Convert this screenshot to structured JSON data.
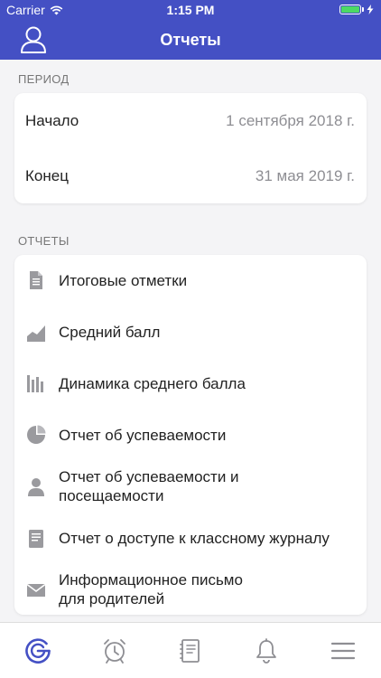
{
  "status_bar": {
    "carrier": "Carrier",
    "time": "1:15 PM"
  },
  "header": {
    "title": "Отчеты"
  },
  "period": {
    "section_label": "ПЕРИОД",
    "start": {
      "label": "Начало",
      "value": "1 сентября 2018 г."
    },
    "end": {
      "label": "Конец",
      "value": "31 мая 2019 г."
    }
  },
  "reports": {
    "section_label": "ОТЧЕТЫ",
    "items": [
      {
        "label": "Итоговые отметки",
        "icon": "document-icon"
      },
      {
        "label": "Средний балл",
        "icon": "area-chart-icon"
      },
      {
        "label": "Динамика среднего балла",
        "icon": "bar-chart-icon"
      },
      {
        "label": "Отчет об успеваемости",
        "icon": "pie-chart-icon"
      },
      {
        "label_line1": "Отчет об успеваемости и",
        "label_line2": "посещаемости",
        "icon": "person-icon"
      },
      {
        "label": "Отчет о доступе к классному журналу",
        "icon": "journal-icon"
      },
      {
        "label_line1": "Информационное письмо",
        "label_line2": "для родителей",
        "icon": "envelope-icon"
      }
    ]
  },
  "tabbar": {
    "tabs": [
      "home-logo-icon",
      "alarm-clock-icon",
      "notebook-icon",
      "bell-icon",
      "menu-icon"
    ],
    "active_color": "#4450c4",
    "inactive_color": "#8e8e93"
  },
  "colors": {
    "brand": "#4450c4",
    "icon_gray": "#9a9a9e"
  }
}
